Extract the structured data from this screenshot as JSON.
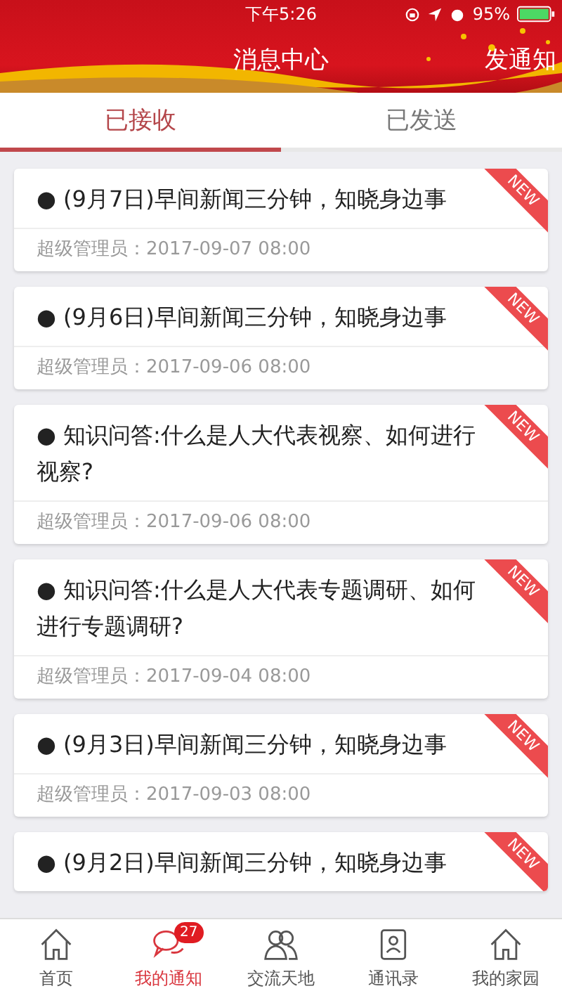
{
  "status_bar": {
    "time": "下午5:26",
    "battery": "95%"
  },
  "header": {
    "title": "消息中心",
    "action": "发通知"
  },
  "tabs": [
    {
      "label": "已接收",
      "selected": true
    },
    {
      "label": "已发送",
      "selected": false
    }
  ],
  "messages": [
    {
      "title": "● (9月7日)早间新闻三分钟，知晓身边事",
      "meta": "超级管理员：2017-09-07 08:00",
      "badge": "NEW"
    },
    {
      "title": "● (9月6日)早间新闻三分钟，知晓身边事",
      "meta": "超级管理员：2017-09-06 08:00",
      "badge": "NEW"
    },
    {
      "title": "● 知识问答:什么是人大代表视察、如何进行视察?",
      "meta": "超级管理员：2017-09-06 08:00",
      "badge": "NEW"
    },
    {
      "title": "● 知识问答:什么是人大代表专题调研、如何进行专题调研?",
      "meta": "超级管理员：2017-09-04 08:00",
      "badge": "NEW"
    },
    {
      "title": "● (9月3日)早间新闻三分钟，知晓身边事",
      "meta": "超级管理员：2017-09-03 08:00",
      "badge": "NEW"
    },
    {
      "title": "● (9月2日)早间新闻三分钟，知晓身边事",
      "badge": "NEW"
    }
  ],
  "nav": [
    {
      "label": "首页",
      "kind": "home",
      "selected": false
    },
    {
      "label": "我的通知",
      "kind": "chat",
      "selected": true,
      "badge": "27"
    },
    {
      "label": "交流天地",
      "kind": "people",
      "selected": false
    },
    {
      "label": "通讯录",
      "kind": "contacts",
      "selected": false
    },
    {
      "label": "我的家园",
      "kind": "garden",
      "selected": false
    }
  ]
}
